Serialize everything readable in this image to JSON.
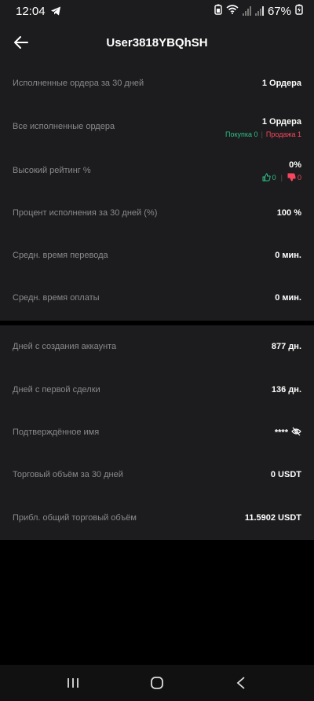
{
  "status_bar": {
    "time": "12:04",
    "battery": "67%"
  },
  "header": {
    "title": "User3818YBQhSH"
  },
  "stats": {
    "orders_30d_label": "Исполненные ордера за 30 дней",
    "orders_30d_value": "1 Ордера",
    "all_orders_label": "Все исполненные ордера",
    "all_orders_value": "1 Ордера",
    "buy_label": "Покупка 0",
    "sep": "|",
    "sell_label": "Продажа 1",
    "rating_label": "Высокий рейтинг %",
    "rating_value": "0%",
    "positive_count": "0",
    "negative_count": "0",
    "completion_label": "Процент исполнения за 30 дней (%)",
    "completion_value": "100 %",
    "transfer_time_label": "Средн. время перевода",
    "transfer_time_value": "0 мин.",
    "pay_time_label": "Средн. время оплаты",
    "pay_time_value": "0 мин."
  },
  "account": {
    "account_age_label": "Дней с создания аккаунта",
    "account_age_value": "877 дн.",
    "first_trade_label": "Дней с первой сделки",
    "first_trade_value": "136 дн.",
    "verified_name_label": "Подтверждённое имя",
    "verified_name_value": "****",
    "volume_30d_label": "Торговый объём за 30 дней",
    "volume_30d_value": "0 USDT",
    "total_volume_label": "Прибл. общий торговый объём",
    "total_volume_value": "11.5902 USDT"
  },
  "colors": {
    "background": "#000000",
    "card": "#1c1c1e",
    "label": "#8a8a8e",
    "buy": "#2ebd85",
    "sell": "#f6465d"
  },
  "icons": [
    "telegram-icon",
    "wifi-icon",
    "signal-icon",
    "battery-icon",
    "back-arrow-icon",
    "thumbs-up-icon",
    "thumbs-down-icon",
    "eye-off-icon",
    "recent-apps-icon",
    "home-icon",
    "back-nav-icon"
  ]
}
